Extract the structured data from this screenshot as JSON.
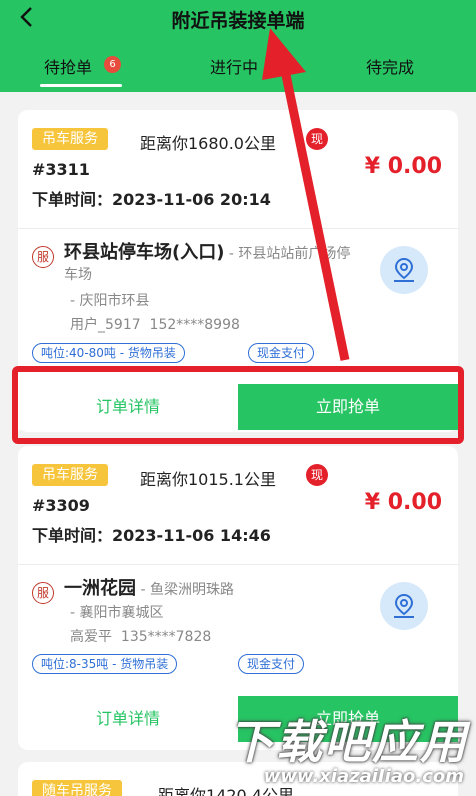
{
  "header": {
    "back_icon": "chevron-left-icon",
    "title": "附近吊装接单端"
  },
  "tabs": [
    {
      "label": "待抢单",
      "badge": "6",
      "active": true
    },
    {
      "label": "进行中"
    },
    {
      "label": "待完成"
    }
  ],
  "orders": [
    {
      "service": "吊车服务",
      "distance": "距离你1680.0公里",
      "cash_badge": "现",
      "order_no": "#3311",
      "price": "¥ 0.00",
      "time_label": "下单时间：",
      "time": "2023-11-06 20:14",
      "service_mark": "服",
      "place_name": "环县站停车场(入口)",
      "place_detail": " - 环县站站前广场停车场",
      "city": "- 庆阳市环县",
      "user": "用户_5917",
      "phone": "152****8998",
      "tag_tonnage": "吨位:40-80吨 - 货物吊装",
      "tag_payment": "现金支付",
      "btn_detail": "订单详情",
      "btn_grab": "立即抢单"
    },
    {
      "service": "吊车服务",
      "distance": "距离你1015.1公里",
      "cash_badge": "现",
      "order_no": "#3309",
      "price": "¥ 0.00",
      "time_label": "下单时间：",
      "time": "2023-11-06 14:46",
      "service_mark": "服",
      "place_name": "一洲花园",
      "place_detail": " - 鱼梁洲明珠路",
      "city": "- 襄阳市襄城区",
      "user": "高爱平",
      "phone": "135****7828",
      "tag_tonnage": "吨位:8-35吨 - 货物吊装",
      "tag_payment": "现金支付",
      "btn_detail": "订单详情",
      "btn_grab": "立即抢单"
    },
    {
      "service": "随车吊服务",
      "distance": "距离你1420.4公里"
    }
  ],
  "watermark": {
    "main": "下载吧应用",
    "url": "www.xiazaiIiao.com"
  },
  "colors": {
    "brand_green": "#27c463",
    "price_red": "#e4202a",
    "service_yellow": "#f7c53c",
    "tag_blue": "#2f6fd6"
  }
}
